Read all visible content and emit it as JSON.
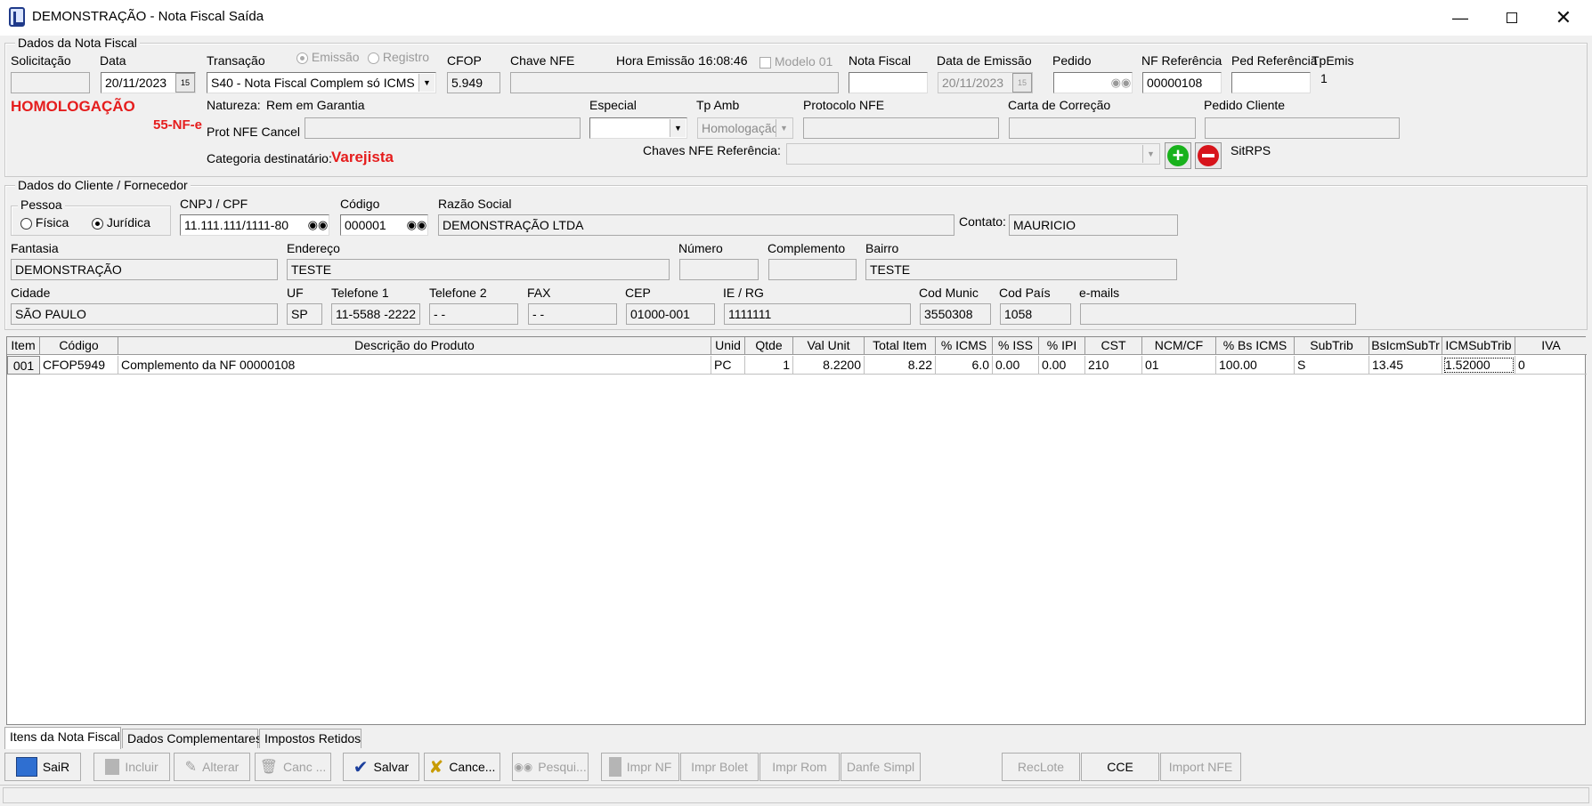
{
  "window": {
    "title": "DEMONSTRAÇÃO - Nota Fiscal Saída"
  },
  "nota": {
    "legend": "Dados da Nota Fiscal",
    "solicitacao_label": "Solicitação",
    "solicitacao_value": "",
    "data_label": "Data",
    "data_value": "20/11/2023",
    "transacao_label": "Transação",
    "transacao_value": "S40 - Nota Fiscal Complem só ICMS s/I",
    "emissao_label": "Emissão",
    "registro_label": "Registro",
    "cfop_label": "CFOP",
    "cfop_value": "5.949",
    "chave_label": "Chave NFE",
    "chave_value": "",
    "hora_label": "Hora Emissão :",
    "hora_value": "16:08:46",
    "modelo_label": "Modelo 01",
    "nf_label": "Nota Fiscal",
    "nf_value": "",
    "data_emissao_label": "Data de Emissão",
    "data_emissao_value": "20/11/2023",
    "pedido_label": "Pedido",
    "pedido_value": "",
    "nf_ref_label": "NF Referência",
    "nf_ref_value": "00000108",
    "ped_ref_label": "Ped Referência",
    "ped_ref_value": "",
    "tpemis_label": "TpEmis",
    "tpemis_value": "1",
    "ambiente": "HOMOLOGAÇÃO",
    "modelo_nfe": "55-NF-e",
    "natureza_label": "Natureza:",
    "natureza_value": "Rem em Garantia",
    "prot_cancel_label": "Prot NFE Cancel",
    "prot_cancel_value": "",
    "especial_label": "Especial",
    "especial_value": "",
    "tpamb_label": "Tp Amb",
    "tpamb_value": "Homologação",
    "protocolo_label": "Protocolo NFE",
    "protocolo_value": "",
    "carta_label": "Carta de Correção",
    "carta_value": "",
    "pedido_cliente_label": "Pedido Cliente",
    "pedido_cliente_value": "",
    "categoria_label": "Categoria destinatário:",
    "categoria_value": "Varejista",
    "chaves_ref_label": "Chaves NFE Referência:",
    "chaves_ref_value": "",
    "sitrps_label": "SitRPS"
  },
  "cliente": {
    "legend": "Dados do Cliente / Fornecedor",
    "pessoa_legend": "Pessoa",
    "fisica_label": "Física",
    "juridica_label": "Jurídica",
    "cnpj_label": "CNPJ / CPF",
    "cnpj_value": "11.111.111/1111-80",
    "codigo_label": "Código",
    "codigo_value": "000001",
    "razao_label": "Razão Social",
    "razao_value": "DEMONSTRAÇÃO LTDA",
    "contato_label": "Contato:",
    "contato_value": "MAURICIO",
    "fantasia_label": "Fantasia",
    "fantasia_value": "DEMONSTRAÇÃO",
    "endereco_label": "Endereço",
    "endereco_value": "TESTE",
    "numero_label": "Número",
    "numero_value": "",
    "complemento_label": "Complemento",
    "complemento_value": "",
    "bairro_label": "Bairro",
    "bairro_value": "TESTE",
    "cidade_label": "Cidade",
    "cidade_value": "SÃO PAULO",
    "uf_label": "UF",
    "uf_value": "SP",
    "tel1_label": "Telefone 1",
    "tel1_value": "11-5588 -2222",
    "tel2_label": "Telefone 2",
    "tel2_value": "-   -",
    "fax_label": "FAX",
    "fax_value": "-   -",
    "cep_label": "CEP",
    "cep_value": "01000-001",
    "ie_label": "IE / RG",
    "ie_value": "1111111",
    "codmunic_label": "Cod Munic",
    "codmunic_value": "3550308",
    "codpais_label": "Cod País",
    "codpais_value": "1058",
    "emails_label": "e-mails",
    "emails_value": ""
  },
  "grid": {
    "headers": [
      "Item",
      "Código",
      "Descrição do Produto",
      "Unid",
      "Qtde",
      "Val Unit",
      "Total Item",
      "% ICMS",
      "% ISS",
      "% IPI",
      "CST",
      "NCM/CF",
      "% Bs ICMS",
      "SubTrib",
      "BsIcmSubTr",
      "ICMSubTrib",
      "IVA"
    ],
    "rows": [
      [
        "001",
        "CFOP5949",
        "Complemento da NF 00000108",
        "PC",
        "1",
        "8.2200",
        "8.22",
        "6.0",
        "0.00",
        "0.00",
        "210",
        "01",
        "100.00",
        "S",
        "13.45",
        "1.52000",
        "0"
      ]
    ]
  },
  "tabs": [
    "Itens da Nota Fiscal",
    "Dados Complementares",
    "Impostos Retidos"
  ],
  "toolbar": {
    "sair": "SaiR",
    "incluir": "Incluir",
    "alterar": "Alterar",
    "canc": "Canc ...",
    "salvar": "Salvar",
    "cancelar": "Cance...",
    "pesqui": "Pesqui...",
    "impr_nf": "Impr NF",
    "impr_bolet": "Impr Bolet",
    "impr_rom": "Impr Rom",
    "danfe": "Danfe Simpl",
    "reclote": "RecLote",
    "cce": "CCE",
    "import_nfe": "Import NFE"
  },
  "colors": {
    "accent_red": "#e51d1d",
    "plus_green": "#19b21c",
    "minus_red": "#d7141b"
  }
}
